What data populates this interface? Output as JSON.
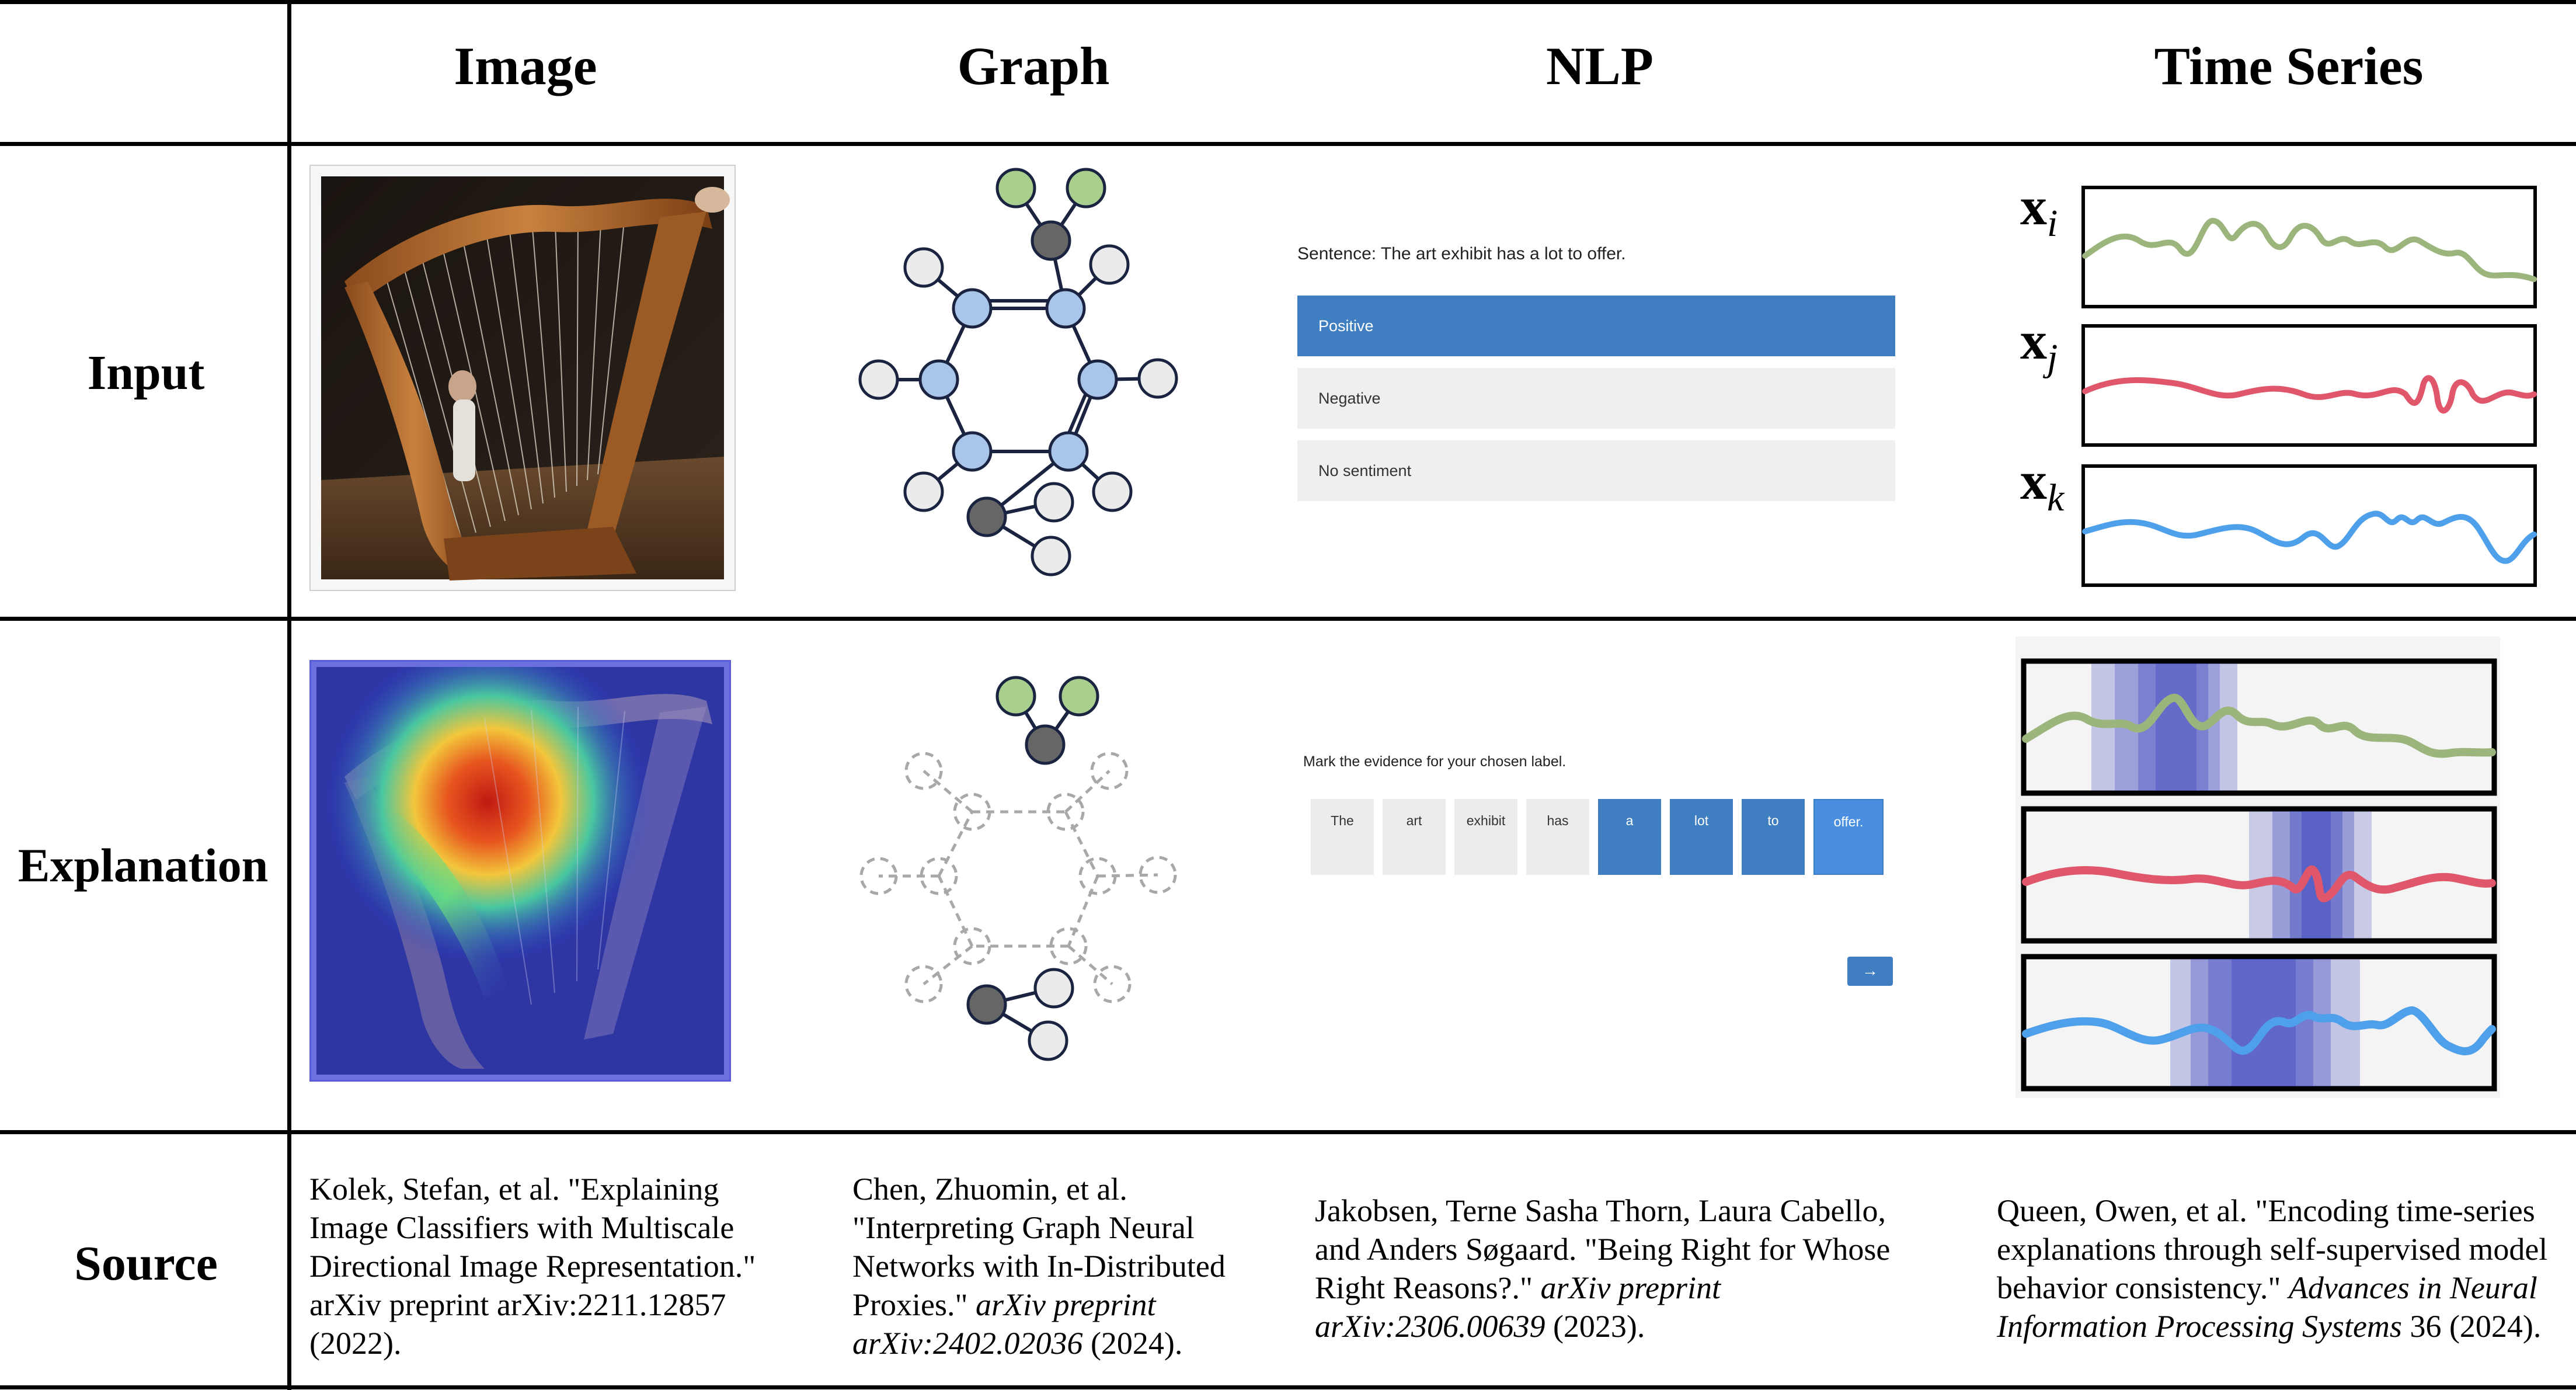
{
  "columns": [
    "Image",
    "Graph",
    "NLP",
    "Time Series"
  ],
  "rows": {
    "input": "Input",
    "explanation": "Explanation",
    "source": "Source"
  },
  "nlp_input": {
    "sentence": "Sentence: The art exhibit has a lot to offer.",
    "options": [
      "Positive",
      "Negative",
      "No sentiment"
    ],
    "selected": "Positive"
  },
  "nlp_explanation": {
    "instruction": "Mark the evidence for your chosen label.",
    "tokens": [
      "The",
      "art",
      "exhibit",
      "has",
      "a",
      "lot",
      "to",
      "offer."
    ],
    "highlighted": [
      "a",
      "lot",
      "to",
      "offer."
    ],
    "next_button": "→"
  },
  "time_series": {
    "labels": [
      {
        "base": "x",
        "sub": "i"
      },
      {
        "base": "x",
        "sub": "j"
      },
      {
        "base": "x",
        "sub": "k"
      }
    ],
    "colors": [
      "#9bb57d",
      "#e0566a",
      "#4fa0ea"
    ]
  },
  "graph_colors": {
    "green": "#a8cf8e",
    "blue": "#a9c6ea",
    "gray": "#ebebeb",
    "dark": "#666666"
  },
  "sources": {
    "image": {
      "pre": "Kolek, Stefan, et al. \"Explaining Image Classifiers with Multiscale Directional Image Representation.\" arXiv preprint arXiv:2211.12857 (2022).",
      "italic": "",
      "post": ""
    },
    "graph": {
      "pre": "Chen, Zhuomin, et al. \"Interpreting Graph Neural Networks with In-Distributed Proxies.\" ",
      "italic": "arXiv preprint arXiv:2402.02036",
      "post": " (2024)."
    },
    "nlp": {
      "pre": "Jakobsen, Terne Sasha Thorn, Laura Cabello, and Anders Søgaard. \"Being Right for Whose Right Reasons?.\" ",
      "italic": "arXiv preprint arXiv:2306.00639",
      "post": " (2023)."
    },
    "ts": {
      "pre": "Queen, Owen, et al. \"Encoding time-series explanations through self-supervised model behavior consistency.\" ",
      "italic": "Advances in Neural Information Processing Systems",
      "post": " 36 (2024)."
    }
  }
}
